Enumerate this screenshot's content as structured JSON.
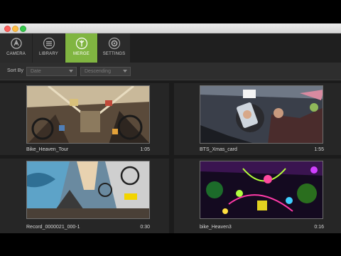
{
  "toolbar": {
    "tabs": [
      {
        "label": "CAMERA",
        "icon": "camera-icon"
      },
      {
        "label": "LIBRARY",
        "icon": "library-icon"
      },
      {
        "label": "MERGE",
        "icon": "merge-icon",
        "active": true
      },
      {
        "label": "SETTINGS",
        "icon": "gear-icon"
      }
    ]
  },
  "filter": {
    "sort_label": "Sort By",
    "sort_value": "Date",
    "order_value": "Descending"
  },
  "clips": [
    {
      "name": "Bike_Heaven_Tour",
      "duration": "1:05"
    },
    {
      "name": "BTS_Xmas_card",
      "duration": "1:55"
    },
    {
      "name": "Record_0000021_000-1",
      "duration": "0:30"
    },
    {
      "name": "bike_Heaven3",
      "duration": "0:16"
    }
  ],
  "colors": {
    "accent": "#80b541",
    "toolbar_bg": "#2b2b2b",
    "panel_bg": "#232323"
  }
}
